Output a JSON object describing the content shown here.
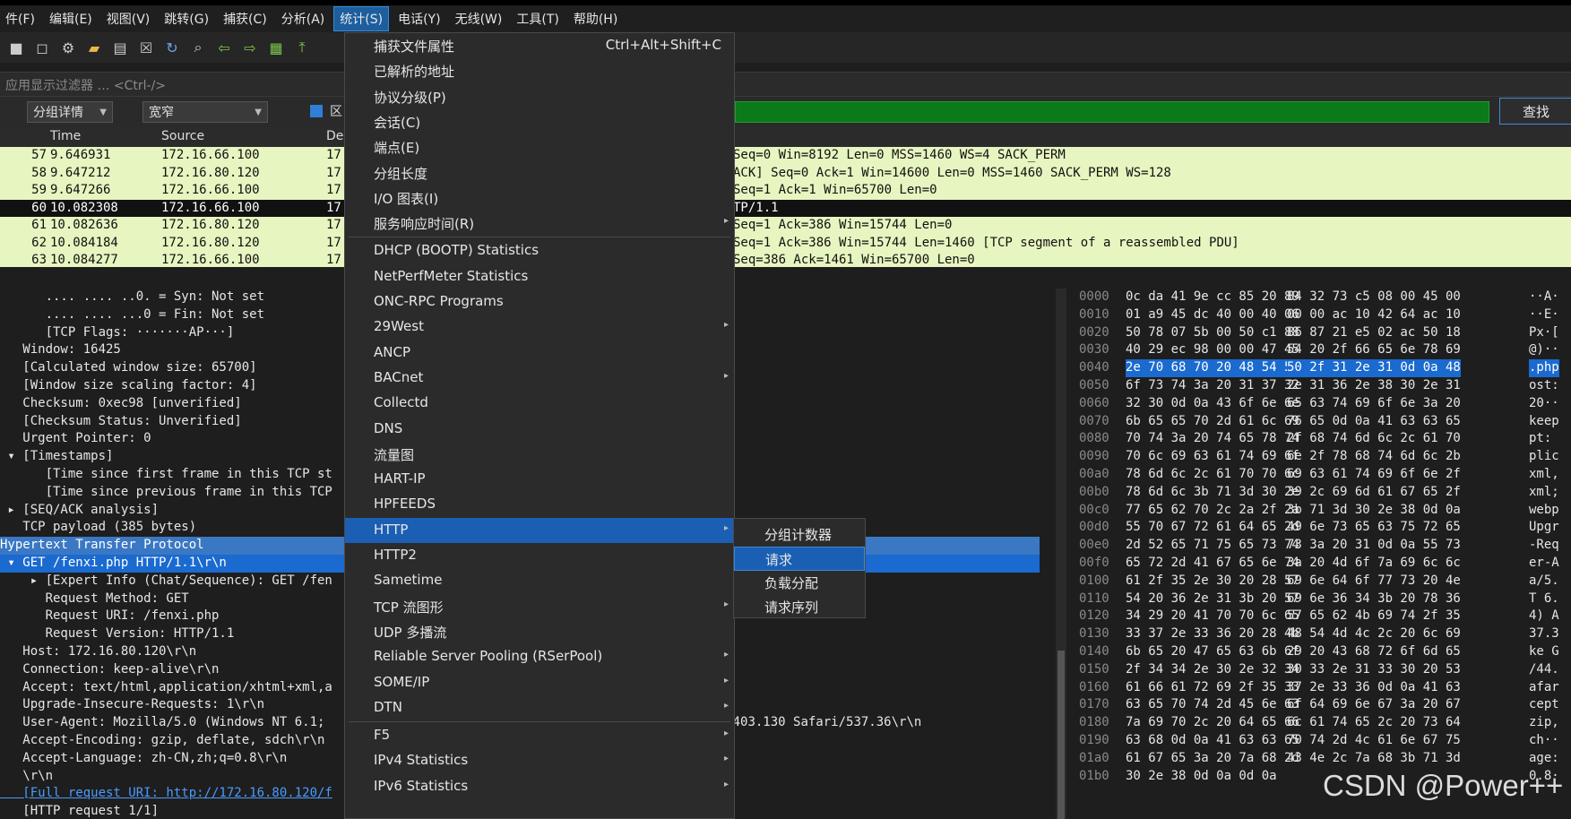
{
  "menubar": {
    "items": [
      "件(F)",
      "编辑(E)",
      "视图(V)",
      "跳转(G)",
      "捕获(C)",
      "分析(A)",
      "统计(S)",
      "电话(Y)",
      "无线(W)",
      "工具(T)",
      "帮助(H)"
    ]
  },
  "filter": {
    "placeholder": "应用显示过滤器 … <Ctrl-/>"
  },
  "findbar": {
    "combo1": "分组详情",
    "combo2": "宽窄",
    "checkbox_label": "区",
    "find_button": "查找"
  },
  "packet_list": {
    "columns": [
      "Time",
      "Source",
      "De"
    ],
    "rows": [
      {
        "no": "57",
        "time": "9.646931",
        "src": "172.16.66.100",
        "dst": "17",
        "info": "Seq=0 Win=8192 Len=0 MSS=1460 WS=4 SACK_PERM"
      },
      {
        "no": "58",
        "time": "9.647212",
        "src": "172.16.80.120",
        "dst": "17",
        "info": "ACK] Seq=0 Ack=1 Win=14600 Len=0 MSS=1460 SACK_PERM WS=128"
      },
      {
        "no": "59",
        "time": "9.647266",
        "src": "172.16.66.100",
        "dst": "17",
        "info": "Seq=1 Ack=1 Win=65700 Len=0"
      },
      {
        "no": "60",
        "time": "10.082308",
        "src": "172.16.66.100",
        "dst": "17",
        "info": "TP/1.1"
      },
      {
        "no": "61",
        "time": "10.082636",
        "src": "172.16.80.120",
        "dst": "17",
        "info": "Seq=1 Ack=386 Win=15744 Len=0"
      },
      {
        "no": "62",
        "time": "10.084184",
        "src": "172.16.80.120",
        "dst": "17",
        "info": "Seq=1 Ack=386 Win=15744 Len=1460 [TCP segment of a reassembled PDU]"
      },
      {
        "no": "63",
        "time": "10.084277",
        "src": "172.16.66.100",
        "dst": "17",
        "info": "Seq=386 Ack=1461 Win=65700 Len=0"
      }
    ]
  },
  "details": [
    "      .... .... ..0. = Syn: Not set",
    "      .... .... ...0 = Fin: Not set",
    "      [TCP Flags: ·······AP···]",
    "   Window: 16425",
    "   [Calculated window size: 65700]",
    "   [Window size scaling factor: 4]",
    "   Checksum: 0xec98 [unverified]",
    "   [Checksum Status: Unverified]",
    "   Urgent Pointer: 0",
    " ▾ [Timestamps]",
    "      [Time since first frame in this TCP st",
    "      [Time since previous frame in this TCP",
    " ▸ [SEQ/ACK analysis]",
    "   TCP payload (385 bytes)",
    "Hypertext Transfer Protocol",
    " ▾ GET /fenxi.php HTTP/1.1\\r\\n",
    "    ▸ [Expert Info (Chat/Sequence): GET /fen",
    "      Request Method: GET",
    "      Request URI: /fenxi.php",
    "      Request Version: HTTP/1.1",
    "   Host: 172.16.80.120\\r\\n",
    "   Connection: keep-alive\\r\\n",
    "   Accept: text/html,application/xhtml+xml,a",
    "   Upgrade-Insecure-Requests: 1\\r\\n",
    "   User-Agent: Mozilla/5.0 (Windows NT 6.1;                                       ) Chrome/44.0.2403.130 Safari/537.36\\r\\n",
    "   Accept-Encoding: gzip, deflate, sdch\\r\\n",
    "   Accept-Language: zh-CN,zh;q=0.8\\r\\n",
    "   \\r\\n",
    "   [Full request URI: http://172.16.80.120/f",
    "   [HTTP request 1/1]"
  ],
  "hex": [
    {
      "off": "0000",
      "b1": "0c da 41 9e cc 85 20 89",
      "b2": "84 32 73 c5 08 00 45 00",
      "asc": "··A·"
    },
    {
      "off": "0010",
      "b1": "01 a9 45 dc 40 00 40 06",
      "b2": "00 00 ac 10 42 64 ac 10",
      "asc": "··E·"
    },
    {
      "off": "0020",
      "b1": "50 78 07 5b 00 50 c1 88",
      "b2": "86 87 21 e5 02 ac 50 18",
      "asc": "Px·["
    },
    {
      "off": "0030",
      "b1": "40 29 ec 98 00 00 47 45",
      "b2": "54 20 2f 66 65 6e 78 69",
      "asc": "@)··"
    },
    {
      "off": "0040",
      "b1": "2e 70 68 70 20 48 54 54",
      "b2": "50 2f 31 2e 31 0d 0a 48",
      "asc": ".php"
    },
    {
      "off": "0050",
      "b1": "6f 73 74 3a 20 31 37 32",
      "b2": "2e 31 36 2e 38 30 2e 31",
      "asc": "ost:"
    },
    {
      "off": "0060",
      "b1": "32 30 0d 0a 43 6f 6e 6e",
      "b2": "65 63 74 69 6f 6e 3a 20",
      "asc": "20··"
    },
    {
      "off": "0070",
      "b1": "6b 65 65 70 2d 61 6c 69",
      "b2": "76 65 0d 0a 41 63 63 65",
      "asc": "keep"
    },
    {
      "off": "0080",
      "b1": "70 74 3a 20 74 65 78 74",
      "b2": "2f 68 74 6d 6c 2c 61 70",
      "asc": "pt: "
    },
    {
      "off": "0090",
      "b1": "70 6c 69 63 61 74 69 6f",
      "b2": "6e 2f 78 68 74 6d 6c 2b",
      "asc": "plic"
    },
    {
      "off": "00a0",
      "b1": "78 6d 6c 2c 61 70 70 6c",
      "b2": "69 63 61 74 69 6f 6e 2f",
      "asc": "xml,"
    },
    {
      "off": "00b0",
      "b1": "78 6d 6c 3b 71 3d 30 2e",
      "b2": "39 2c 69 6d 61 67 65 2f",
      "asc": "xml;"
    },
    {
      "off": "00c0",
      "b1": "77 65 62 70 2c 2a 2f 2a",
      "b2": "3b 71 3d 30 2e 38 0d 0a",
      "asc": "webp"
    },
    {
      "off": "00d0",
      "b1": "55 70 67 72 61 64 65 2d",
      "b2": "49 6e 73 65 63 75 72 65",
      "asc": "Upgr"
    },
    {
      "off": "00e0",
      "b1": "2d 52 65 71 75 65 73 74",
      "b2": "73 3a 20 31 0d 0a 55 73",
      "asc": "-Req"
    },
    {
      "off": "00f0",
      "b1": "65 72 2d 41 67 65 6e 74",
      "b2": "3a 20 4d 6f 7a 69 6c 6c",
      "asc": "er-A"
    },
    {
      "off": "0100",
      "b1": "61 2f 35 2e 30 20 28 57",
      "b2": "69 6e 64 6f 77 73 20 4e",
      "asc": "a/5."
    },
    {
      "off": "0110",
      "b1": "54 20 36 2e 31 3b 20 57",
      "b2": "69 6e 36 34 3b 20 78 36",
      "asc": "T 6."
    },
    {
      "off": "0120",
      "b1": "34 29 20 41 70 70 6c 65",
      "b2": "57 65 62 4b 69 74 2f 35",
      "asc": "4) A"
    },
    {
      "off": "0130",
      "b1": "33 37 2e 33 36 20 28 4b",
      "b2": "48 54 4d 4c 2c 20 6c 69",
      "asc": "37.3"
    },
    {
      "off": "0140",
      "b1": "6b 65 20 47 65 63 6b 6f",
      "b2": "29 20 43 68 72 6f 6d 65",
      "asc": "ke G"
    },
    {
      "off": "0150",
      "b1": "2f 34 34 2e 30 2e 32 34",
      "b2": "30 33 2e 31 33 30 20 53",
      "asc": "/44."
    },
    {
      "off": "0160",
      "b1": "61 66 61 72 69 2f 35 33",
      "b2": "37 2e 33 36 0d 0a 41 63",
      "asc": "afar"
    },
    {
      "off": "0170",
      "b1": "63 65 70 74 2d 45 6e 63",
      "b2": "6f 64 69 6e 67 3a 20 67",
      "asc": "cept"
    },
    {
      "off": "0180",
      "b1": "7a 69 70 2c 20 64 65 66",
      "b2": "6c 61 74 65 2c 20 73 64",
      "asc": "zip,"
    },
    {
      "off": "0190",
      "b1": "63 68 0d 0a 41 63 63 65",
      "b2": "70 74 2d 4c 61 6e 67 75",
      "asc": "ch··"
    },
    {
      "off": "01a0",
      "b1": "61 67 65 3a 20 7a 68 2d",
      "b2": "43 4e 2c 7a 68 3b 71 3d",
      "asc": "age:"
    },
    {
      "off": "01b0",
      "b1": "30 2e 38 0d 0a 0d 0a",
      "b2": "",
      "asc": "0.8·"
    }
  ],
  "stats_menu": {
    "items": [
      {
        "label": "捕获文件属性",
        "shortcut": "Ctrl+Alt+Shift+C"
      },
      {
        "label": "已解析的地址"
      },
      {
        "label": "协议分级(P)"
      },
      {
        "label": "会话(C)"
      },
      {
        "label": "端点(E)"
      },
      {
        "label": "分组长度"
      },
      {
        "label": "I/O 图表(I)"
      },
      {
        "label": "服务响应时间(R)",
        "sub": "▸"
      },
      {
        "label": "DHCP (BOOTP) Statistics"
      },
      {
        "label": "NetPerfMeter Statistics"
      },
      {
        "label": "ONC-RPC Programs"
      },
      {
        "label": "29West",
        "sub": "▸"
      },
      {
        "label": "ANCP"
      },
      {
        "label": "BACnet",
        "sub": "▸"
      },
      {
        "label": "Collectd"
      },
      {
        "label": "DNS"
      },
      {
        "label": "流量图"
      },
      {
        "label": "HART-IP"
      },
      {
        "label": "HPFEEDS"
      },
      {
        "label": "HTTP",
        "sub": "▸"
      },
      {
        "label": "HTTP2"
      },
      {
        "label": "Sametime"
      },
      {
        "label": "TCP 流图形",
        "sub": "▸"
      },
      {
        "label": "UDP 多播流"
      },
      {
        "label": "Reliable Server Pooling (RSerPool)",
        "sub": "▸"
      },
      {
        "label": "SOME/IP",
        "sub": "▸"
      },
      {
        "label": "DTN",
        "sub": "▸"
      },
      {
        "label": "F5",
        "sub": "▸"
      },
      {
        "label": "IPv4 Statistics",
        "sub": "▸"
      },
      {
        "label": "IPv6 Statistics",
        "sub": "▸"
      }
    ]
  },
  "http_submenu": {
    "items": [
      "分组计数器",
      "请求",
      "负载分配",
      "请求序列"
    ]
  },
  "watermark": "CSDN @Power++"
}
